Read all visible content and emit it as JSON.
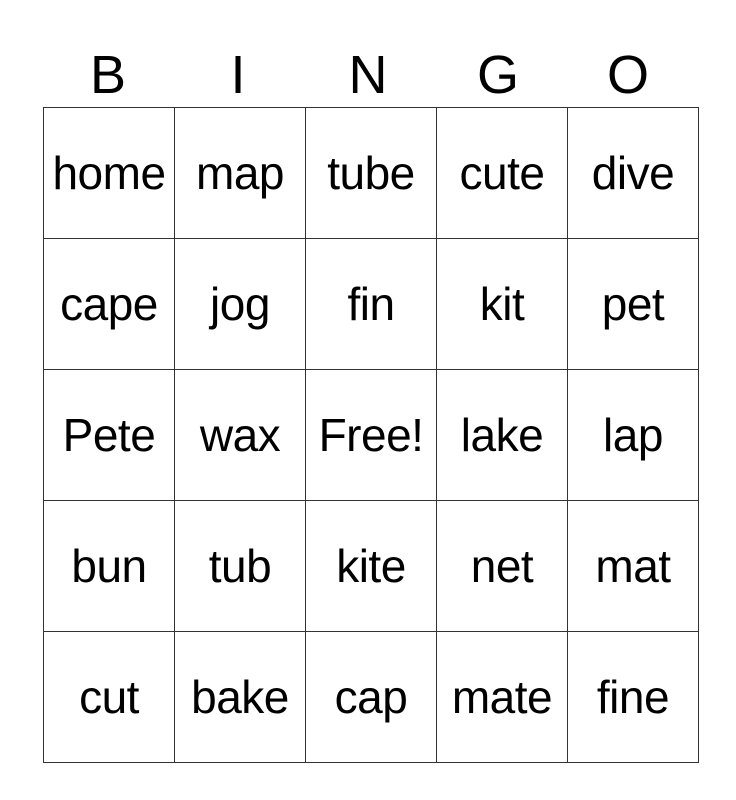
{
  "header": [
    "B",
    "I",
    "N",
    "G",
    "O"
  ],
  "rows": [
    [
      "home",
      "map",
      "tube",
      "cute",
      "dive"
    ],
    [
      "cape",
      "jog",
      "fin",
      "kit",
      "pet"
    ],
    [
      "Pete",
      "wax",
      "Free!",
      "lake",
      "lap"
    ],
    [
      "bun",
      "tub",
      "kite",
      "net",
      "mat"
    ],
    [
      "cut",
      "bake",
      "cap",
      "mate",
      "fine"
    ]
  ]
}
